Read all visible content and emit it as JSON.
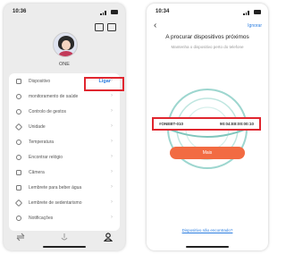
{
  "left_screen": {
    "status_time": "10:36",
    "username": "ONE",
    "menu": [
      {
        "label": "Dispositivo",
        "icon": "device-icon"
      },
      {
        "label": "monitoramento de saúde",
        "icon": "heart-icon"
      },
      {
        "label": "Controlo de gestos",
        "icon": "gesture-icon"
      },
      {
        "label": "Unidade",
        "icon": "ruler-icon"
      },
      {
        "label": "Temperatura",
        "icon": "thermometer-icon"
      },
      {
        "label": "Encontrar relógio",
        "icon": "locate-icon"
      },
      {
        "label": "Câmera",
        "icon": "camera-icon"
      },
      {
        "label": "Lembrete para beber água",
        "icon": "cup-icon"
      },
      {
        "label": "Lembrete de sedentarismo",
        "icon": "sedentary-icon"
      },
      {
        "label": "Notificações",
        "icon": "bell-icon"
      }
    ],
    "connect_label": "Ligar",
    "highlight_color": "#e0262f",
    "link_color": "#2b7de0"
  },
  "right_screen": {
    "status_time": "10:34",
    "skip_label": "Ignorar",
    "title": "A procurar dispositivos próximos",
    "subtitle": "Mantenha o dispositivo perto do telefone",
    "device": {
      "name": "#ONEBT-010",
      "mac": "90:04:E8:00:00:10"
    },
    "more_label": "Mais",
    "not_found_link": "Dispositivo não encontrado?",
    "button_color": "#f26b42"
  }
}
